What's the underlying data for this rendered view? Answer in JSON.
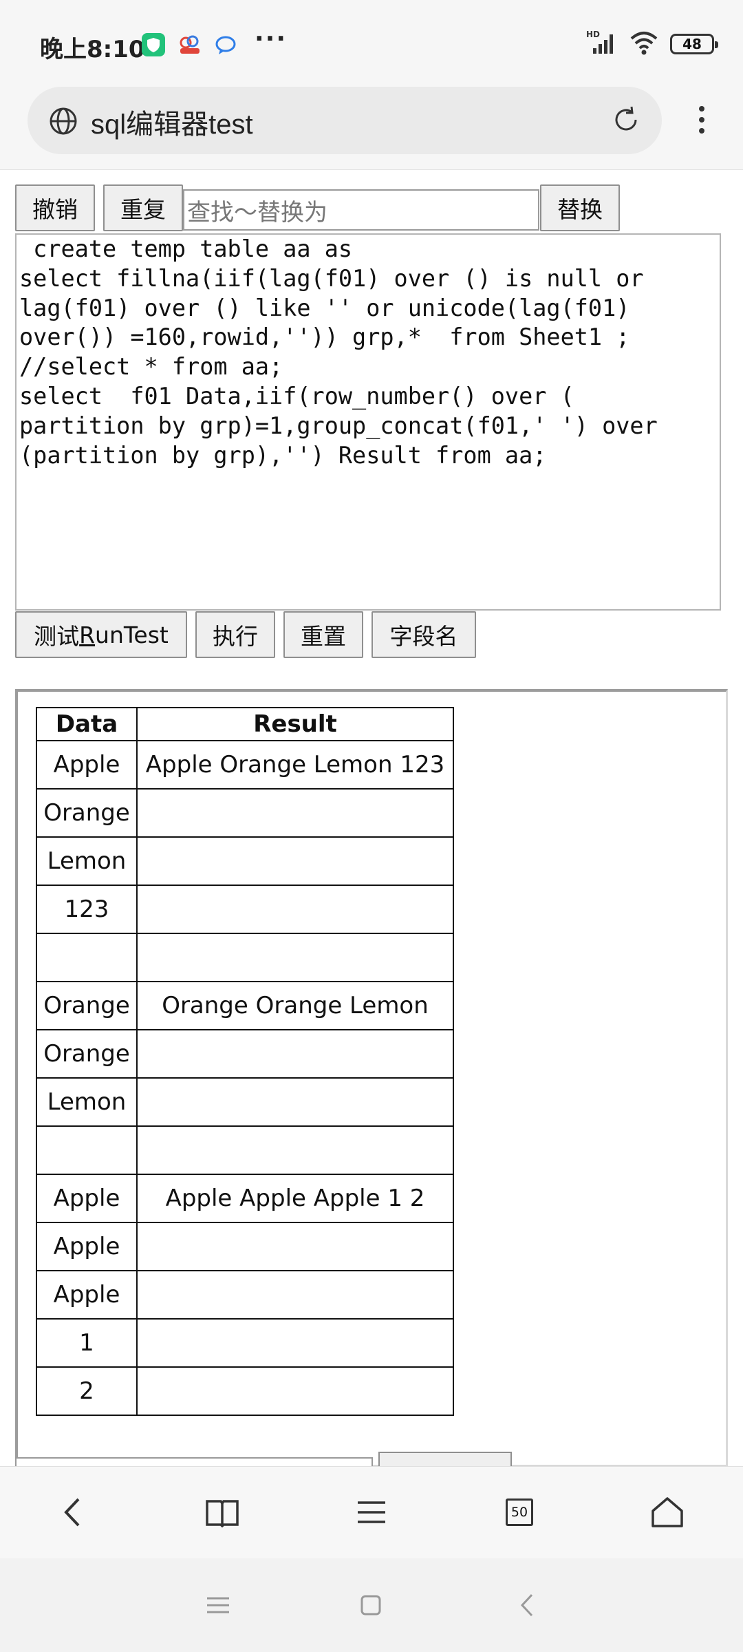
{
  "status_bar": {
    "time": "晚上8:10",
    "battery": "48",
    "network": "HD",
    "icons": [
      "app-icon-green-shield",
      "app-icon-cloud-badge",
      "app-icon-chat-bubble",
      "more-dots",
      "signal-icon",
      "wifi-icon",
      "battery-icon"
    ]
  },
  "browser": {
    "url_title": "sql编辑器test",
    "tab_count": "50"
  },
  "toolbar_top": {
    "undo": "撤销",
    "redo": "重复",
    "find_placeholder": "查找～替换为",
    "replace": "替换"
  },
  "editor": {
    "sql_lines": [
      " create temp table aa as",
      "select fillna(iif(lag(f01) over () is null or",
      "lag(f01) over () like '' or unicode(lag(f01)",
      "over()) =160,rowid,'')) grp,*  from Sheet1 ;",
      "//select * from aa;",
      "select  f01 Data,iif(row_number() over (",
      "partition by grp)=1,group_concat(f01,' ') over",
      "(partition by grp),'') Result from aa;"
    ]
  },
  "actions": {
    "run_test_prefix": "测试",
    "run_test_underlined": "R",
    "run_test_rest": "unTest",
    "execute": "执行",
    "reset": "重置",
    "field_names": "字段名"
  },
  "result_table": {
    "headers": [
      "Data",
      "Result"
    ],
    "rows": [
      [
        "Apple",
        "Apple Orange Lemon 123"
      ],
      [
        "Orange",
        ""
      ],
      [
        "Lemon",
        ""
      ],
      [
        "123",
        ""
      ],
      [
        "",
        ""
      ],
      [
        "Orange",
        "Orange Orange Lemon"
      ],
      [
        "Orange",
        ""
      ],
      [
        "Lemon",
        ""
      ],
      [
        "",
        ""
      ],
      [
        "Apple",
        "Apple Apple Apple 1 2"
      ],
      [
        "Apple",
        ""
      ],
      [
        "Apple",
        ""
      ],
      [
        "1",
        ""
      ],
      [
        "2",
        ""
      ]
    ]
  }
}
